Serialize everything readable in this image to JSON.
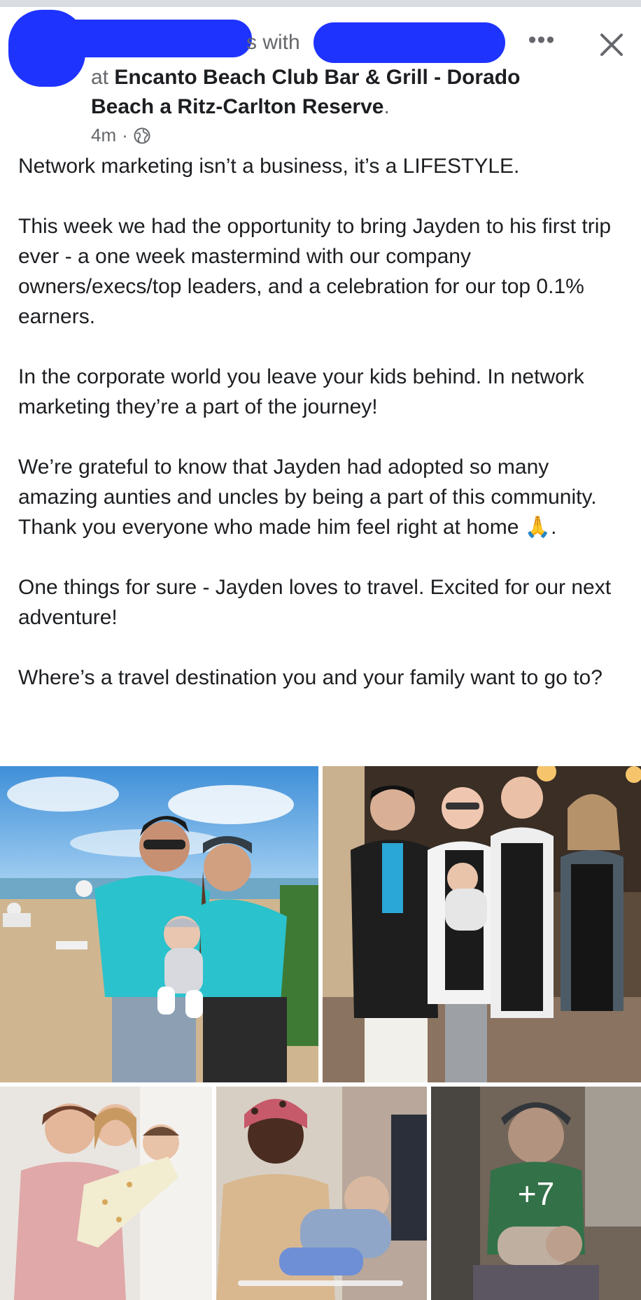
{
  "header": {
    "with_text": "s with",
    "location_prefix": "at ",
    "location_name": "Encanto Beach Club Bar & Grill - Dorado Beach a Ritz-Carlton Reserve",
    "location_suffix": ".",
    "time": "4m",
    "separator": "·",
    "more_label": "•••",
    "audience_icon": "globe-icon",
    "close_icon": "close-icon"
  },
  "post": {
    "paragraphs": [
      "Network marketing isn’t a business, it’s a LIFESTYLE.",
      "This week we had the opportunity to bring Jayden to his first trip ever - a one week mastermind with our company owners/execs/top leaders, and a celebration for our top 0.1% earners.",
      "In the corporate world you leave your kids behind. In network marketing they’re a part of the journey!",
      "We’re grateful to know that Jayden had adopted so many amazing aunties and uncles by being a part of this community. Thank you everyone who made him feel right at home 🙏.",
      "One things for sure - Jayden loves to travel. Excited for our next adventure!",
      "Where’s a travel destination you and your family want to go to?"
    ]
  },
  "photos": {
    "more_count": "+7"
  },
  "colors": {
    "redaction": "#1f33ff",
    "text_primary": "#1c1e21",
    "text_secondary": "#65676b"
  }
}
